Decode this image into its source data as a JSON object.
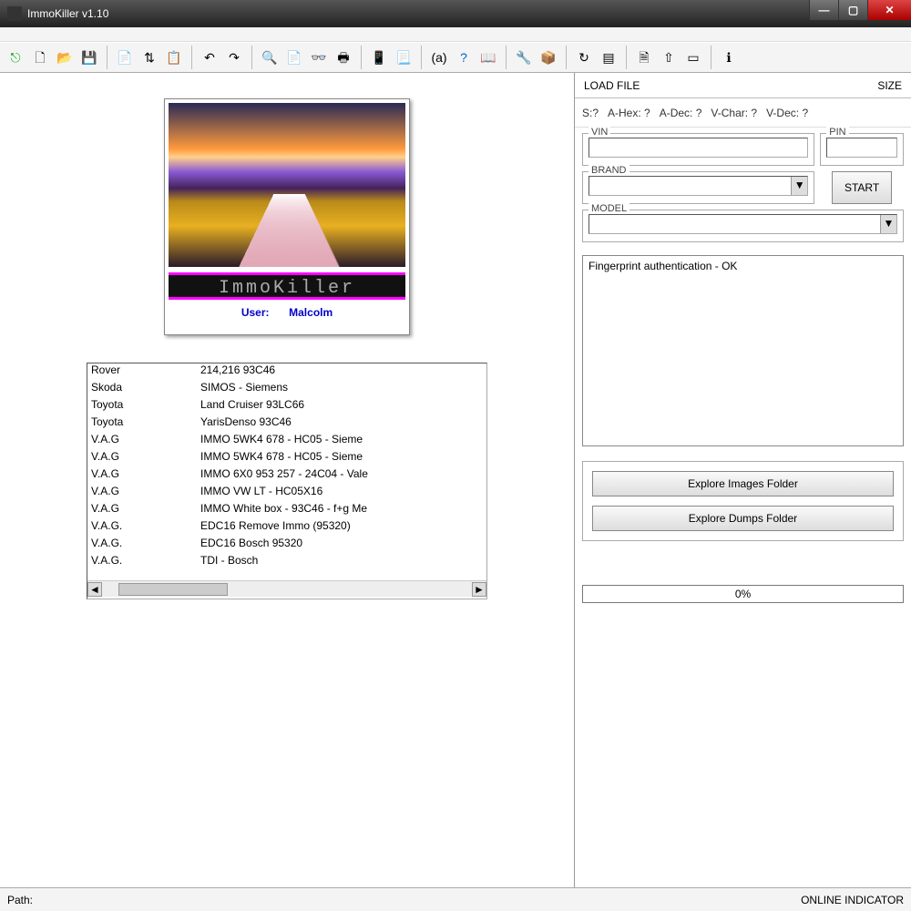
{
  "window": {
    "title": "ImmoKiller v1.10"
  },
  "splash": {
    "brand_text": "ImmoKiller",
    "user_label": "User:",
    "user_name": "Malcolm"
  },
  "toolbar_icons": [
    "exit-icon",
    "doc-new-icon",
    "doc-open-icon",
    "doc-save-icon",
    "sep",
    "copy-icon",
    "updown-icon",
    "paste-icon",
    "sep",
    "undo-icon",
    "redo-icon",
    "sep",
    "find-icon",
    "page-icon",
    "binoculars-icon",
    "print-icon",
    "sep",
    "calc-icon",
    "page2-icon",
    "sep",
    "hex-icon",
    "help-icon",
    "book-icon",
    "sep",
    "wrench-icon",
    "box-icon",
    "sep",
    "refresh-icon",
    "chip-icon",
    "sep",
    "doc2-icon",
    "up-icon",
    "select-icon",
    "sep",
    "info-icon"
  ],
  "list": [
    {
      "brand": "Rover",
      "model": "214,216 93C46"
    },
    {
      "brand": "Skoda",
      "model": "SIMOS - Siemens"
    },
    {
      "brand": "Toyota",
      "model": "Land Cruiser 93LC66"
    },
    {
      "brand": "Toyota",
      "model": "YarisDenso  93C46"
    },
    {
      "brand": "V.A.G",
      "model": "IMMO 5WK4 678  - HC05 - Sieme"
    },
    {
      "brand": "V.A.G",
      "model": "IMMO 5WK4 678  - HC05 - Sieme"
    },
    {
      "brand": "V.A.G",
      "model": "IMMO 6X0 953 257 - 24C04 - Vale"
    },
    {
      "brand": "V.A.G",
      "model": "IMMO VW LT       - HC05X16"
    },
    {
      "brand": "V.A.G",
      "model": "IMMO White box  - 93C46 - f+g Me"
    },
    {
      "brand": "V.A.G.",
      "model": "EDC16  Remove Immo (95320)"
    },
    {
      "brand": "V.A.G.",
      "model": "EDC16 Bosch 95320"
    },
    {
      "brand": "V.A.G.",
      "model": "TDI - Bosch"
    }
  ],
  "right": {
    "load_file_label": "LOAD FILE",
    "size_label": "SIZE",
    "stats": {
      "s": "S:?",
      "ahex": "A-Hex: ?",
      "adec": "A-Dec: ?",
      "vchar": "V-Char: ?",
      "vdec": "V-Dec: ?"
    },
    "vin_label": "VIN",
    "pin_label": "PIN",
    "brand_label": "BRAND",
    "model_label": "MODEL",
    "start_label": "START",
    "log_text": "Fingerprint authentication - OK",
    "explore_images": "Explore Images Folder",
    "explore_dumps": "Explore Dumps Folder",
    "progress_label": "0%"
  },
  "status": {
    "path_label": "Path:",
    "online_label": "ONLINE INDICATOR"
  },
  "colors": {
    "accent_magenta": "#ff00ff",
    "link_blue": "#0000cc"
  }
}
